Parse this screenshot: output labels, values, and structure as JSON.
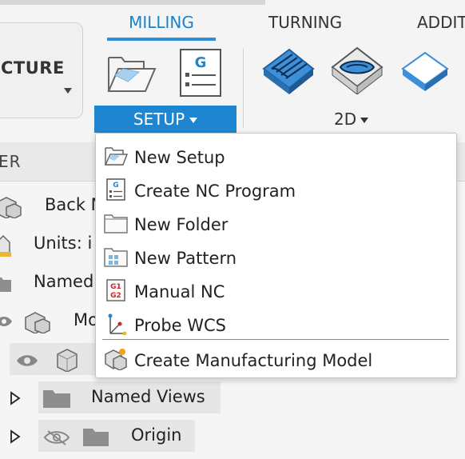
{
  "tabs": {
    "milling": "MILLING",
    "turning": "TURNING",
    "additive": "ADDITI"
  },
  "workspace": {
    "label": "CTURE"
  },
  "toolbar": {
    "setup_label": "SETUP",
    "twod_label": "2D"
  },
  "browser": {
    "header": "ER",
    "rows": [
      {
        "label": "Back M"
      },
      {
        "label": "Units: i"
      },
      {
        "label": "Named"
      },
      {
        "label": "Mo"
      },
      {
        "label": "Named Views"
      },
      {
        "label": "Origin"
      }
    ]
  },
  "menu": {
    "items": [
      {
        "label": "New Setup",
        "icon": "new-setup-icon"
      },
      {
        "label": "Create NC Program",
        "icon": "nc-program-icon"
      },
      {
        "label": "New Folder",
        "icon": "folder-icon"
      },
      {
        "label": "New Pattern",
        "icon": "pattern-icon"
      },
      {
        "label": "Manual NC",
        "icon": "manual-nc-icon"
      },
      {
        "label": "Probe WCS",
        "icon": "probe-wcs-icon"
      },
      {
        "label": "Create Manufacturing Model",
        "icon": "manufacturing-model-icon"
      }
    ],
    "nc_glyph": "G",
    "manual_nc_glyph_1": "G1",
    "manual_nc_glyph_2": "G2"
  },
  "colors": {
    "accent": "#1e86d0",
    "tab_active": "#1d83c6"
  }
}
